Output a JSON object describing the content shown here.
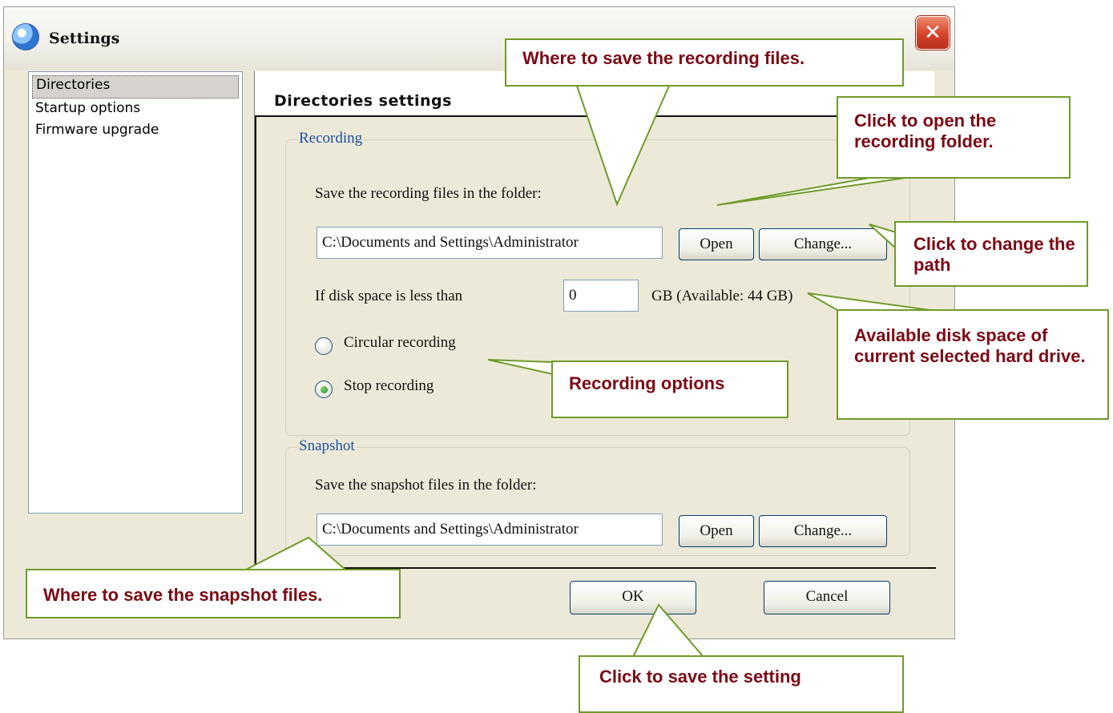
{
  "window": {
    "title": "Settings",
    "icon": "app-icon",
    "close_icon": "close-icon"
  },
  "nav": {
    "items": [
      {
        "label": "Directories",
        "selected": true
      },
      {
        "label": "Startup options",
        "selected": false
      },
      {
        "label": "Firmware upgrade",
        "selected": false
      }
    ]
  },
  "page": {
    "title": "Directories settings"
  },
  "recording": {
    "group_label": "Recording",
    "folder_prompt": "Save the recording files in the folder:",
    "path_value": "C:\\Documents and Settings\\Administrator",
    "open_label": "Open",
    "change_label": "Change...",
    "disk_space_label": "If disk space is less than",
    "disk_space_value": "0",
    "available_text": "GB (Available: 44 GB)",
    "option_circular": "Circular recording",
    "option_stop": "Stop recording",
    "selected_option": "Stop recording"
  },
  "snapshot": {
    "group_label": "Snapshot",
    "folder_prompt": "Save the snapshot files in the folder:",
    "path_value": "C:\\Documents and Settings\\Administrator",
    "open_label": "Open",
    "change_label": "Change..."
  },
  "footer": {
    "ok_label": "OK",
    "cancel_label": "Cancel"
  },
  "callouts": {
    "recording_path": "Where to save the recording files.",
    "open_folder": "Click to open the recording folder.",
    "change_path": "Click to change the path",
    "available_space": "Available disk space of current selected hard drive.",
    "recording_options": "Recording options",
    "snapshot_path": "Where to save the snapshot files.",
    "save_setting": "Click to save the setting"
  },
  "colors": {
    "callout_text": "#7b0a14",
    "callout_border": "#6f9b2a",
    "group_label": "#1d4fa0",
    "dialog_bg": "#ece9d8"
  }
}
